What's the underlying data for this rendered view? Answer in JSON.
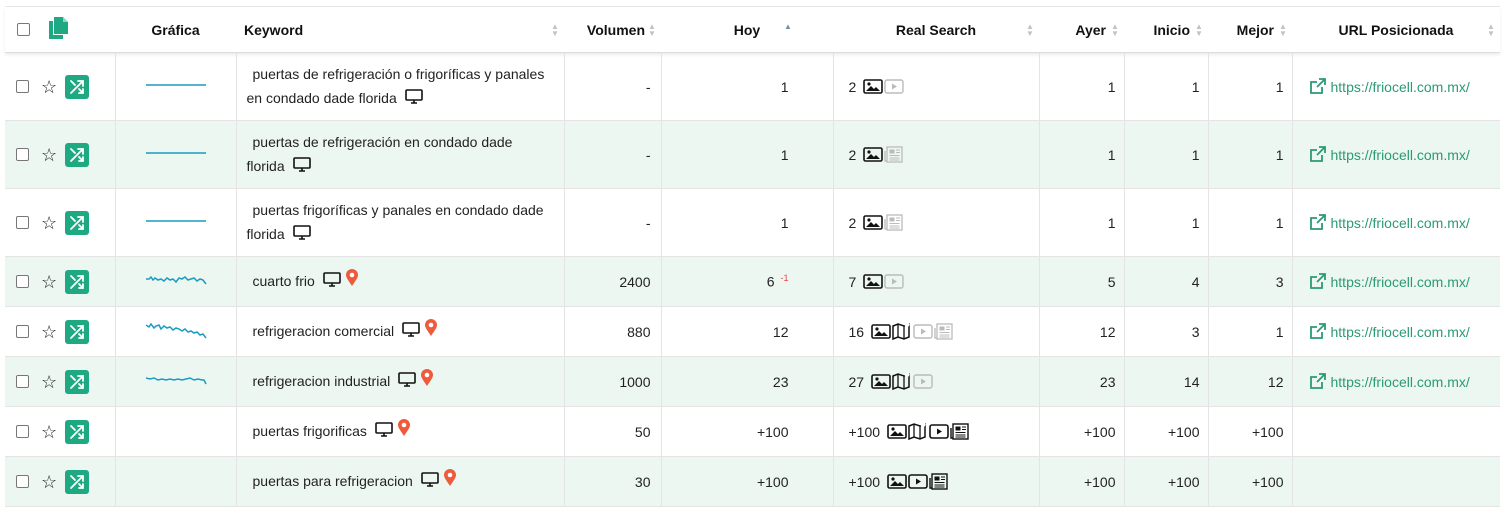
{
  "header": {
    "grafica": "Gráfica",
    "keyword": "Keyword",
    "volumen": "Volumen",
    "hoy": "Hoy",
    "real_search": "Real Search",
    "ayer": "Ayer",
    "inicio": "Inicio",
    "mejor": "Mejor",
    "url": "URL Posicionada"
  },
  "colors": {
    "accent": "#1fa982",
    "row_alt": "#edf7f2",
    "link": "#2a9a75",
    "pin": "#ef5a3c",
    "chart": "#1a9bc0"
  },
  "rows": [
    {
      "keyword": "puertas de refrigeración o frigoríficas y panales en condado dade florida",
      "volumen": "-",
      "hoy": "1",
      "delta": "",
      "real": "2",
      "features": [
        "image-icon",
        "video-icon"
      ],
      "ayer": "1",
      "inicio": "1",
      "mejor": "1",
      "url": "https://friocell.com.mx/",
      "pin": false,
      "chart": "flat"
    },
    {
      "keyword": "puertas de refrigeración en condado dade florida",
      "volumen": "-",
      "hoy": "1",
      "delta": "",
      "real": "2",
      "features": [
        "image-icon",
        "news-icon"
      ],
      "ayer": "1",
      "inicio": "1",
      "mejor": "1",
      "url": "https://friocell.com.mx/",
      "pin": false,
      "chart": "flat"
    },
    {
      "keyword": "puertas frigoríficas y panales en condado dade florida",
      "volumen": "-",
      "hoy": "1",
      "delta": "",
      "real": "2",
      "features": [
        "image-icon",
        "news-icon"
      ],
      "ayer": "1",
      "inicio": "1",
      "mejor": "1",
      "url": "https://friocell.com.mx/",
      "pin": false,
      "chart": "flat"
    },
    {
      "keyword": "cuarto frio",
      "volumen": "2400",
      "hoy": "6",
      "delta": "-1",
      "real": "7",
      "features": [
        "image-icon",
        "video-icon"
      ],
      "ayer": "5",
      "inicio": "4",
      "mejor": "3",
      "url": "https://friocell.com.mx/",
      "pin": true,
      "chart": "a"
    },
    {
      "keyword": "refrigeracion comercial",
      "volumen": "880",
      "hoy": "12",
      "delta": "",
      "real": "16",
      "features": [
        "image-icon",
        "map-icon",
        "video-icon",
        "news-icon"
      ],
      "ayer": "12",
      "inicio": "3",
      "mejor": "1",
      "url": "https://friocell.com.mx/",
      "pin": true,
      "chart": "b"
    },
    {
      "keyword": "refrigeracion industrial",
      "volumen": "1000",
      "hoy": "23",
      "delta": "",
      "real": "27",
      "features": [
        "image-icon",
        "map-icon",
        "video-icon"
      ],
      "ayer": "23",
      "inicio": "14",
      "mejor": "12",
      "url": "https://friocell.com.mx/",
      "pin": true,
      "chart": "c"
    },
    {
      "keyword": "puertas frigorificas",
      "volumen": "50",
      "hoy": "+100",
      "delta": "",
      "real": "+100",
      "features": [
        "image-icon",
        "map-icon",
        "video-icon",
        "news-icon"
      ],
      "ayer": "+100",
      "inicio": "+100",
      "mejor": "+100",
      "url": "",
      "pin": true,
      "chart": ""
    },
    {
      "keyword": "puertas para refrigeracion",
      "volumen": "30",
      "hoy": "+100",
      "delta": "",
      "real": "+100",
      "features": [
        "image-icon",
        "video-icon",
        "news-icon"
      ],
      "ayer": "+100",
      "inicio": "+100",
      "mejor": "+100",
      "url": "",
      "pin": true,
      "chart": ""
    }
  ]
}
